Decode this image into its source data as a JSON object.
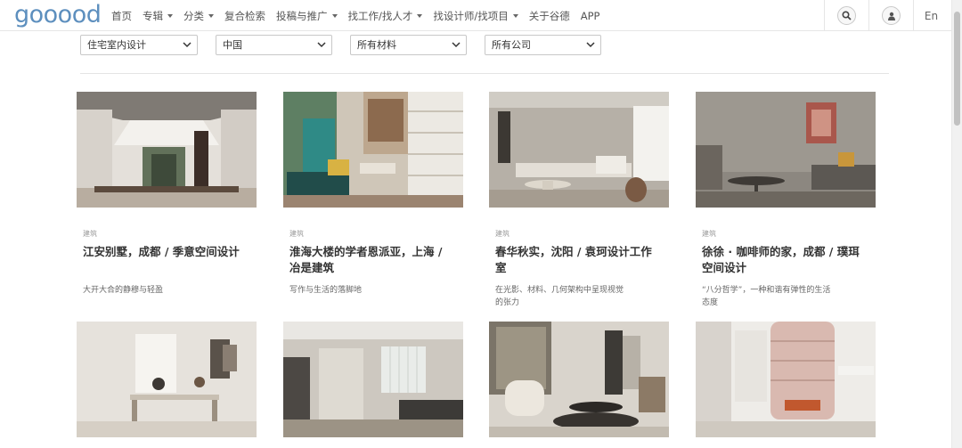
{
  "nav": {
    "logo": "gooood",
    "items": [
      {
        "label": "首页",
        "dropdown": false
      },
      {
        "label": "专辑",
        "dropdown": true
      },
      {
        "label": "分类",
        "dropdown": true
      },
      {
        "label": "复合检索",
        "dropdown": false
      },
      {
        "label": "投稿与推广",
        "dropdown": true
      },
      {
        "label": "找工作/找人才",
        "dropdown": true
      },
      {
        "label": "找设计师/找项目",
        "dropdown": true
      },
      {
        "label": "关于谷德",
        "dropdown": false
      },
      {
        "label": "APP",
        "dropdown": false
      }
    ],
    "search_icon": "search-icon",
    "user_icon": "user-icon",
    "lang": "En"
  },
  "filters": [
    "住宅室内设计",
    "中国",
    "所有材料",
    "所有公司"
  ],
  "cards": [
    {
      "category": "建筑",
      "title": "江安别墅，成都 / 季意空间设计",
      "desc": "大开大合的静穆与轻盈"
    },
    {
      "category": "建筑",
      "title": "淮海大楼的学者恩派亚，上海 / 冶是建筑",
      "desc": "写作与生活的落脚地"
    },
    {
      "category": "建筑",
      "title": "春华秋实，沈阳 / 袁珂设计工作室",
      "desc": "在光影、材料、几何架构中呈现视觉的张力"
    },
    {
      "category": "建筑",
      "title": "徐徐 · 咖啡师的家，成都 / 璞珥空间设计",
      "desc": "“八分哲学”，一种和谐有弹性的生活态度"
    },
    {
      "category": "",
      "title": "",
      "desc": ""
    },
    {
      "category": "",
      "title": "",
      "desc": ""
    },
    {
      "category": "",
      "title": "",
      "desc": ""
    },
    {
      "category": "",
      "title": "",
      "desc": ""
    }
  ],
  "colors": {
    "logo": "#5d8fbe",
    "text": "#333333",
    "muted": "#9a9a9a",
    "border": "#c8c8c8"
  }
}
